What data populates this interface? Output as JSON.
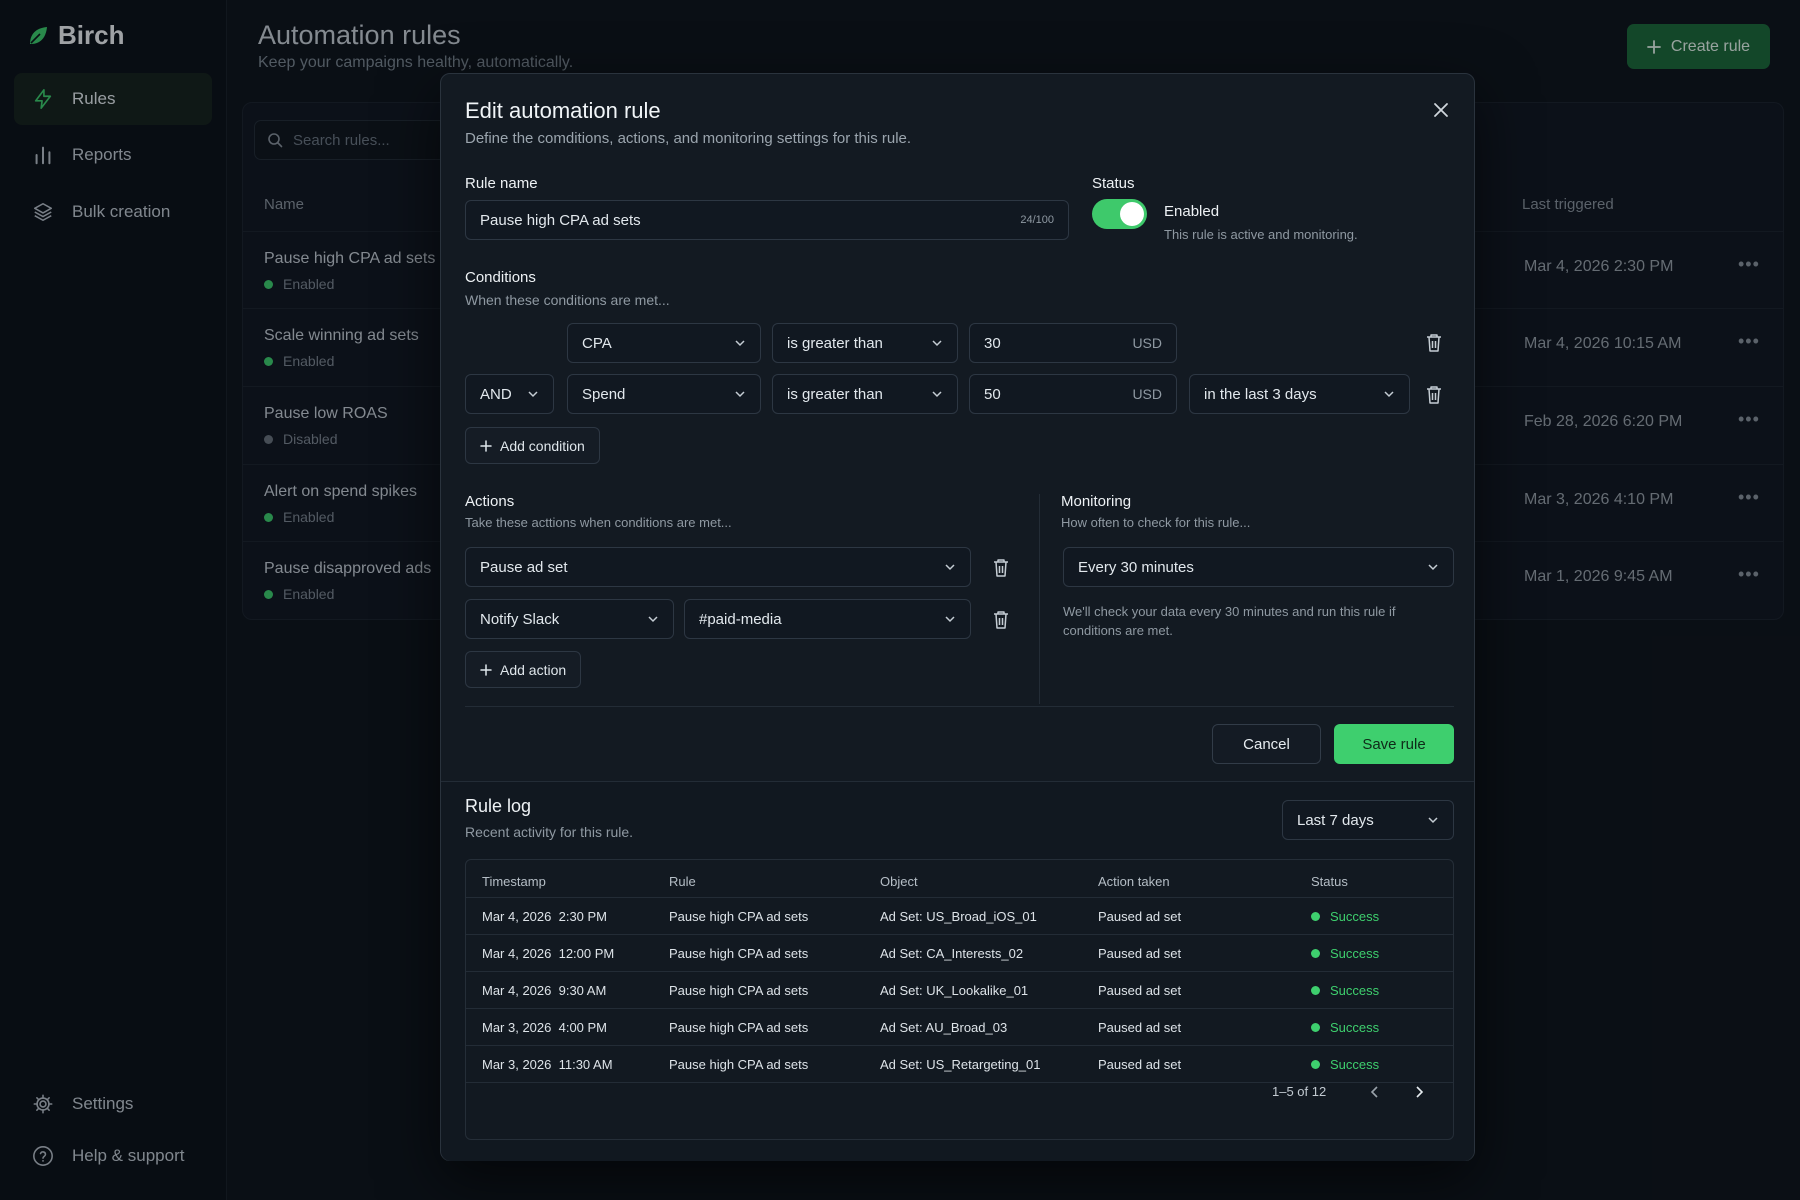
{
  "app": {
    "name": "Birch"
  },
  "sidebar": {
    "items": [
      {
        "label": "Rules",
        "icon": "bolt-icon"
      },
      {
        "label": "Reports",
        "icon": "bar-chart-icon"
      },
      {
        "label": "Bulk creation",
        "icon": "layers-icon"
      }
    ],
    "bottom": [
      {
        "label": "Settings",
        "icon": "gear-icon"
      },
      {
        "label": "Help & support",
        "icon": "help-circle-icon"
      }
    ]
  },
  "page": {
    "title": "Automation rules",
    "subtitle": "Keep your campaigns healthy, automatically.",
    "create_label": "Create rule",
    "search_placeholder": "Search rules...",
    "columns": {
      "name": "Name",
      "last_triggered": "Last triggered"
    },
    "rules": [
      {
        "name": "Pause high CPA ad sets",
        "status": "Enabled",
        "last": "Mar 4, 2026 2:30 PM"
      },
      {
        "name": "Scale winning ad sets",
        "status": "Enabled",
        "last": "Mar 4, 2026 10:15 AM"
      },
      {
        "name": "Pause low ROAS",
        "status": "Disabled",
        "last": "Feb 28, 2026 6:20 PM"
      },
      {
        "name": "Alert on spend spikes",
        "status": "Enabled",
        "last": "Mar 3, 2026 4:10 PM"
      },
      {
        "name": "Pause disapproved ads",
        "status": "Enabled",
        "last": "Mar 1, 2026 9:45 AM"
      }
    ]
  },
  "modal": {
    "title": "Edit automation rule",
    "subtitle": "Define the comditions, actions, and monitoring settings for this rule.",
    "rule_name_label": "Rule name",
    "rule_name_value": "Pause high CPA ad sets",
    "rule_name_count": "24/100",
    "status_label": "Status",
    "status_value": "Enabled",
    "status_hint": "This rule is active and monitoring.",
    "conditions_label": "Conditions",
    "conditions_hint": "When these conditions are met...",
    "conditions": [
      {
        "metric": "CPA",
        "operator": "is greater than",
        "value": "30",
        "unit": "USD"
      },
      {
        "join": "AND",
        "metric": "Spend",
        "operator": "is greater than",
        "value": "50",
        "unit": "USD",
        "window": "in the last 3 days"
      }
    ],
    "add_condition": "Add condition",
    "actions_label": "Actions",
    "actions_hint": "Take these acttions when conditions are met...",
    "actions": [
      {
        "action": "Pause ad set"
      },
      {
        "action": "Notify Slack",
        "target": "#paid-media"
      }
    ],
    "add_action": "Add action",
    "monitoring_label": "Monitoring",
    "monitoring_hint": "How often to check for this rule...",
    "monitoring_value": "Every 30 minutes",
    "monitoring_note": "We'll check your data every 30 minutes and run this rule if conditions are met.",
    "cancel": "Cancel",
    "save": "Save rule",
    "log": {
      "title": "Rule log",
      "subtitle": "Recent activity for this rule.",
      "range": "Last 7 days",
      "headers": [
        "Timestamp",
        "Rule",
        "Object",
        "Action taken",
        "Status"
      ],
      "rows": [
        [
          "Mar 4, 2026  2:30 PM",
          "Pause high CPA ad sets",
          "Ad Set: US_Broad_iOS_01",
          "Paused ad set",
          "Success"
        ],
        [
          "Mar 4, 2026  12:00 PM",
          "Pause high CPA ad sets",
          "Ad Set: CA_Interests_02",
          "Paused ad set",
          "Success"
        ],
        [
          "Mar 4, 2026  9:30 AM",
          "Pause high CPA ad sets",
          "Ad Set: UK_Lookalike_01",
          "Paused ad set",
          "Success"
        ],
        [
          "Mar 3, 2026  4:00 PM",
          "Pause high CPA ad sets",
          "Ad Set: AU_Broad_03",
          "Paused ad set",
          "Success"
        ],
        [
          "Mar 3, 2026  11:30 AM",
          "Pause high CPA ad sets",
          "Ad Set: US_Retargeting_01",
          "Paused ad set",
          "Success"
        ]
      ],
      "pagination": "1–5 of 12"
    }
  },
  "colors": {
    "accent": "#3ecf6e",
    "enabled": "#3ecf6e",
    "disabled": "#6b747d"
  }
}
